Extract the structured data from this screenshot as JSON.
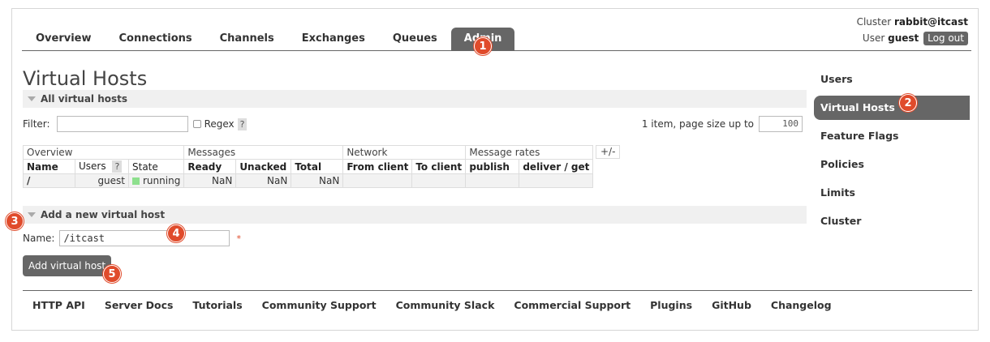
{
  "header": {
    "cluster_label": "Cluster",
    "cluster_name": "rabbit@itcast",
    "user_label": "User",
    "user_name": "guest",
    "logout_label": "Log out"
  },
  "tabs": [
    {
      "label": "Overview"
    },
    {
      "label": "Connections"
    },
    {
      "label": "Channels"
    },
    {
      "label": "Exchanges"
    },
    {
      "label": "Queues"
    },
    {
      "label": "Admin"
    }
  ],
  "badges": [
    "1",
    "2",
    "3",
    "4",
    "5"
  ],
  "main": {
    "title": "Virtual Hosts",
    "all_section": "All virtual hosts",
    "filter_label": "Filter:",
    "regex_label": "Regex",
    "help_label": "?",
    "paging_text": "1 item, page size up to",
    "page_size": "100",
    "plusminus": "+/-",
    "table": {
      "groups": [
        "Overview",
        "Messages",
        "Network",
        "Message rates"
      ],
      "columns": [
        "Name",
        "Users",
        "State",
        "Ready",
        "Unacked",
        "Total",
        "From client",
        "To client",
        "publish",
        "deliver / get"
      ],
      "users_help": "?",
      "rows": [
        {
          "name": "/",
          "users": "guest",
          "state": "running",
          "ready": "NaN",
          "unacked": "NaN",
          "total": "NaN",
          "from_client": "",
          "to_client": "",
          "publish": "",
          "deliver_get": ""
        }
      ]
    },
    "add_section": "Add a new virtual host",
    "name_label": "Name:",
    "name_value": "/itcast",
    "required_mark": "*",
    "add_button": "Add virtual host"
  },
  "sidebar": {
    "items": [
      {
        "label": "Users"
      },
      {
        "label": "Virtual Hosts"
      },
      {
        "label": "Feature Flags"
      },
      {
        "label": "Policies"
      },
      {
        "label": "Limits"
      },
      {
        "label": "Cluster"
      }
    ]
  },
  "footer": {
    "links": [
      "HTTP API",
      "Server Docs",
      "Tutorials",
      "Community Support",
      "Community Slack",
      "Commercial Support",
      "Plugins",
      "GitHub",
      "Changelog"
    ]
  },
  "colors": {
    "accent_dark": "#666666",
    "badge": "#e04b2b",
    "running": "#8ee08e"
  }
}
